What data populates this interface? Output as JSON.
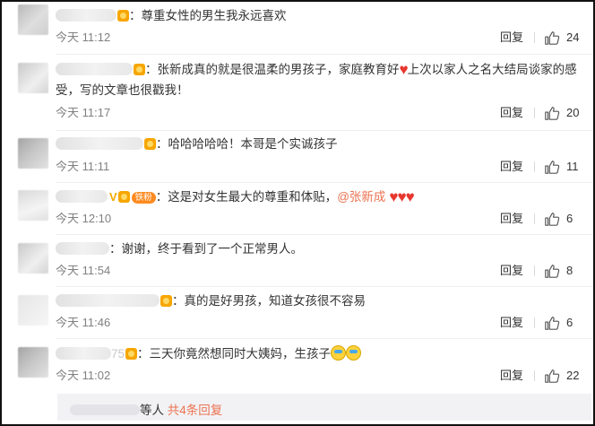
{
  "comments": [
    {
      "text": "尊重女性的男生我永远喜欢",
      "time": "今天 11:12",
      "reply": "回复",
      "likes": "24"
    },
    {
      "text": "张新成真的就是很温柔的男孩子，家庭教育好",
      "text_after": "上次以家人之名大结局谈家的感受，写的文章也很戳我！",
      "time": "今天 11:17",
      "reply": "回复",
      "likes": "20"
    },
    {
      "text": "哈哈哈哈哈！本哥是个实诚孩子",
      "time": "今天 11:11",
      "reply": "回复",
      "likes": "11"
    },
    {
      "badge_label": "铁粉",
      "text": "这是对女生最大的尊重和体贴，",
      "mention": "@张新成",
      "time": "今天 12:10",
      "reply": "回复",
      "likes": "6"
    },
    {
      "text": "谢谢，终于看到了一个正常男人。",
      "time": "今天 11:54",
      "reply": "回复",
      "likes": "8"
    },
    {
      "text": "真的是好男孩，知道女孩很不容易",
      "time": "今天 11:46",
      "reply": "回复",
      "likes": "6"
    },
    {
      "name_fragment": "75",
      "text": "三天你竟然想同时大姨妈，生孩子",
      "time": "今天 11:02",
      "reply": "回复",
      "likes": "22"
    }
  ],
  "replies_bar": {
    "who_suffix": "等人",
    "more": "共4条回复"
  },
  "icons": {
    "like": "thumbs-up-icon",
    "heart": "red-heart-emoji",
    "badge": "fan-badge-icon",
    "verified": "verified-v-icon",
    "crying": "crying-laughing-emoji"
  },
  "colors": {
    "mention": "#eb7350",
    "heart": "#e8372f",
    "time": "#808080",
    "fan_badge": "#ff8a1f"
  }
}
